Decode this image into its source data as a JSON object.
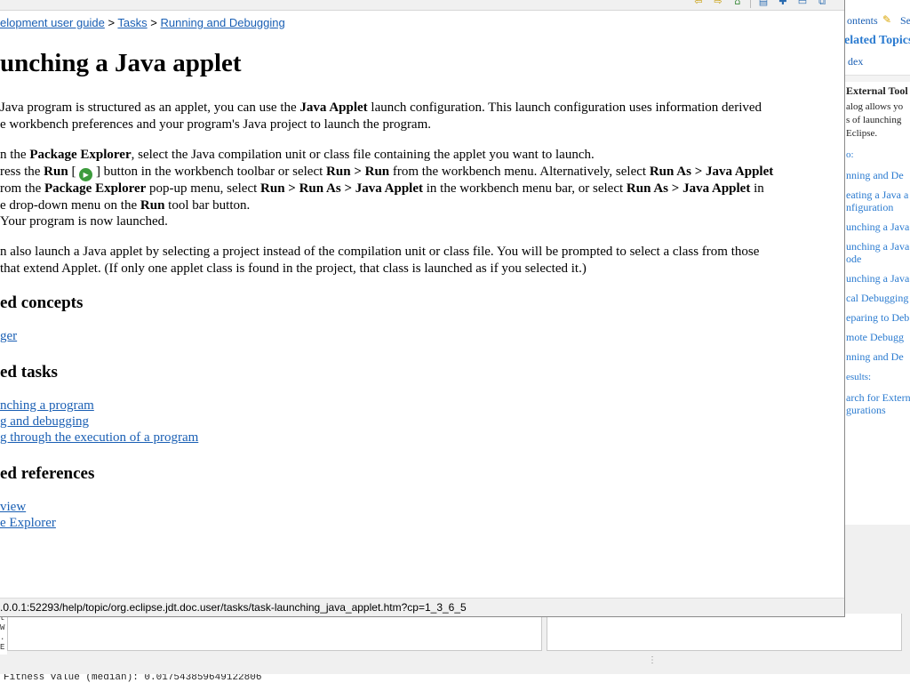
{
  "help": {
    "breadcrumb": {
      "part1": "elopment user guide",
      "sep": ">",
      "part2": "Tasks",
      "part3": "Running and Debugging"
    },
    "title": "unching a Java applet",
    "intro": {
      "l1a": " Java program is structured as an applet, you can use the ",
      "l1b": "Java Applet",
      "l1c": " launch configuration.  This launch configuration uses information derived",
      "l2": "e workbench preferences and your program's Java project to launch the program."
    },
    "steps": {
      "s1a": "n the ",
      "s1b": "Package Explorer",
      "s1c": ", select the Java compilation unit or class file containing the applet you want to launch.",
      "s2a": "ress the ",
      "s2b": "Run",
      "s2c": " [ ",
      "s2d": " ] button in the workbench toolbar or select ",
      "s2e": "Run > Run",
      "s2f": " from the workbench menu. Alternatively, select ",
      "s2g": "Run As > Java Applet",
      "s3a": "rom the ",
      "s3b": "Package Explorer",
      "s3c": " pop-up menu, select ",
      "s3d": "Run > Run As > Java Applet",
      "s3e": " in the workbench menu bar, or select ",
      "s3f": "Run As > Java Applet",
      "s3g": " in",
      "s4a": "e drop-down menu on the ",
      "s4b": "Run",
      "s4c": " tool bar button.",
      "s5": "Your program is now launched."
    },
    "also": {
      "l1": "n also launch a Java applet by selecting a project instead of the compilation unit or class file.  You will be prompted to select a class from those",
      "l2": "that extend Applet.  (If only one applet class is found in the project, that class is launched as if you selected it.)"
    },
    "concepts_heading": "ed concepts",
    "concepts_links": [
      "ger"
    ],
    "tasks_heading": "ed tasks",
    "tasks_links": [
      "nching a program",
      "g and debugging",
      "g through the execution of a program"
    ],
    "references_heading": "ed references",
    "references_links": [
      "view",
      "e Explorer"
    ],
    "status_url": ".0.0.1:52293/help/topic/org.eclipse.jdt.doc.user/tasks/task-launching_java_applet.htm?cp=1_3_6_5"
  },
  "sidebar": {
    "contents": "ontents",
    "search": "Se",
    "related_title": "elated Topics",
    "index": "dex",
    "section_header": "External Tool",
    "desc": [
      "alog allows yo",
      "s of launching",
      "Eclipse."
    ],
    "label_also": "o:",
    "links": [
      "nning and De",
      "eating a Java a",
      "nfiguration",
      "unching a Java",
      "unching a Java",
      "ode",
      "unching a Java",
      "cal Debugging",
      "eparing to Deb",
      "mote Debugg",
      "nning and De"
    ],
    "results_label": "esults:",
    "result_links": [
      "arch for Extern",
      "gurations"
    ]
  },
  "ide": {
    "console_text": "Fitness value (median): 0.017543859649122806",
    "gutter": [
      "t",
      "W",
      ".",
      "E"
    ]
  },
  "colors": {
    "link": "#1a5fb4",
    "sidebar_link": "#2b7bd0",
    "run_icon": "#3c9b3c"
  }
}
